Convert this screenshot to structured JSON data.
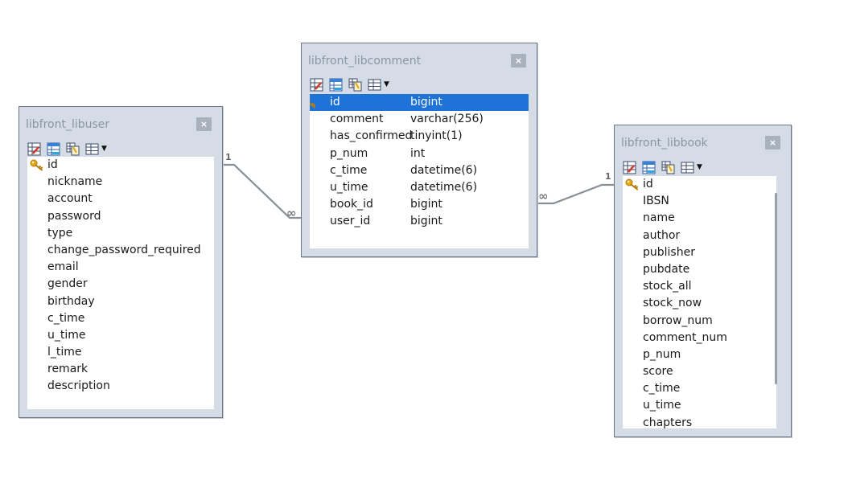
{
  "tables": {
    "user": {
      "title": "libfront_libuser",
      "close_label": "×",
      "fields": [
        "id",
        "nickname",
        "account",
        "password",
        "type",
        "change_password_required",
        "email",
        "gender",
        "birthday",
        "c_time",
        "u_time",
        "l_time",
        "remark",
        "description"
      ]
    },
    "comment": {
      "title": "libfront_libcomment",
      "close_label": "×",
      "selected_field": "id",
      "fields": [
        {
          "name": "id",
          "type": "bigint"
        },
        {
          "name": "comment",
          "type": "varchar(256)"
        },
        {
          "name": "has_confirmed",
          "type": "tinyint(1)"
        },
        {
          "name": "p_num",
          "type": "int"
        },
        {
          "name": "c_time",
          "type": "datetime(6)"
        },
        {
          "name": "u_time",
          "type": "datetime(6)"
        },
        {
          "name": "book_id",
          "type": "bigint"
        },
        {
          "name": "user_id",
          "type": "bigint"
        }
      ]
    },
    "book": {
      "title": "libfront_libbook",
      "close_label": "×",
      "fields": [
        "id",
        "IBSN",
        "name",
        "author",
        "publisher",
        "pubdate",
        "stock_all",
        "stock_now",
        "borrow_num",
        "comment_num",
        "p_num",
        "score",
        "c_time",
        "u_time",
        "chapters"
      ]
    }
  },
  "relations": [
    {
      "from": "libfront_libuser",
      "to": "libfront_libcomment",
      "one_label": "1",
      "many_label": "∞"
    },
    {
      "from": "libfront_libbook",
      "to": "libfront_libcomment",
      "one_label": "1",
      "many_label": "∞"
    }
  ],
  "icons": {
    "primary_key": "key-icon",
    "toolbar": [
      "edit-table-icon",
      "design-table-icon",
      "copy-table-icon",
      "table-grid-icon",
      "dropdown-caret-icon"
    ]
  },
  "colors": {
    "selection": "#1e73d9",
    "key": "#e6a516",
    "panel": "#d6dce6",
    "title_text": "#8b95a4",
    "connector": "#8a8f96"
  }
}
